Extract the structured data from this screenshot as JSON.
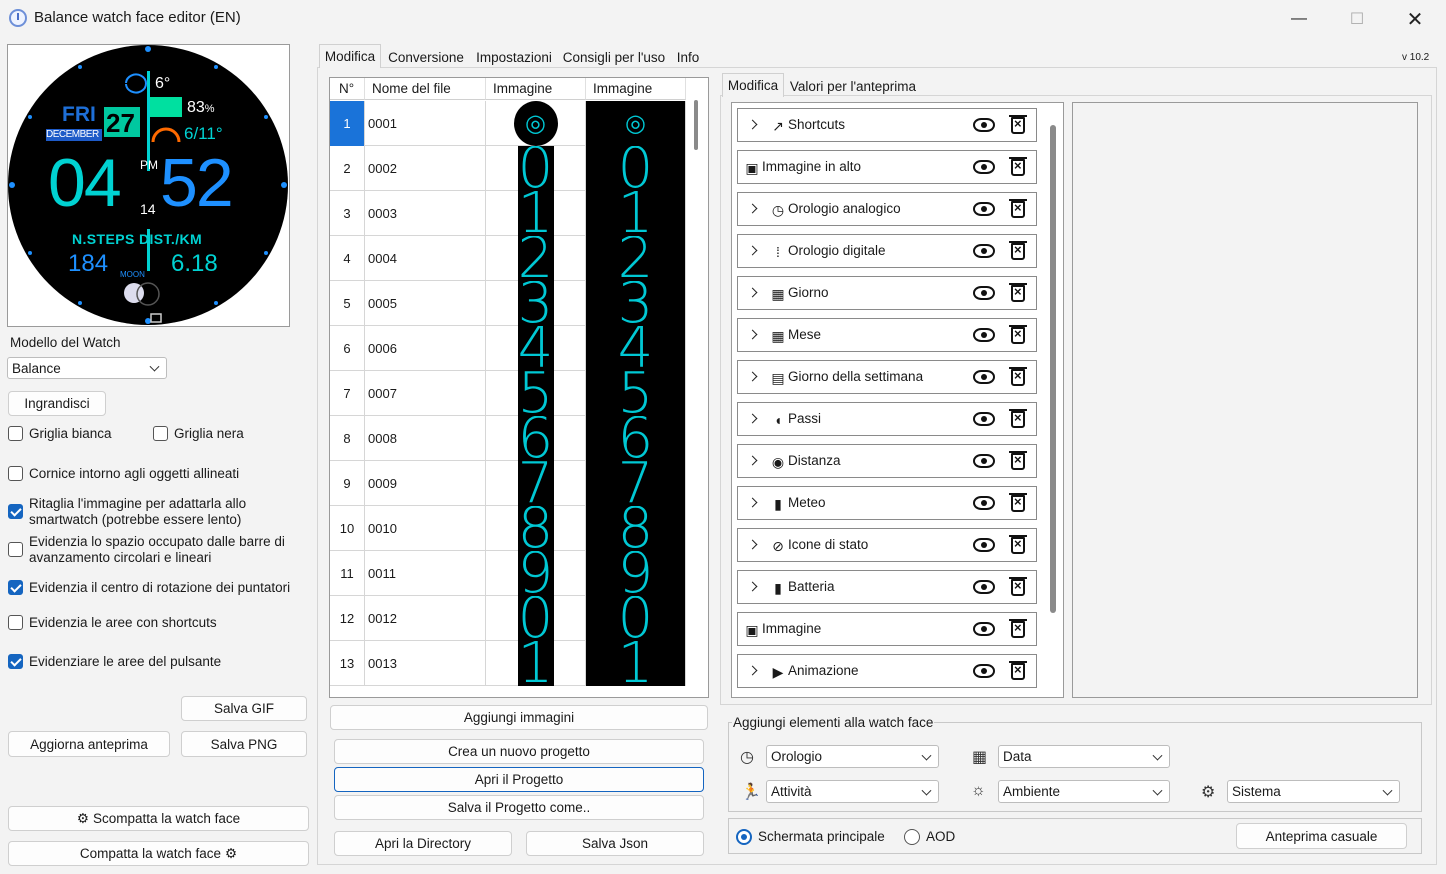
{
  "window": {
    "title": "Balance watch face editor (EN)",
    "version": "v 10.2",
    "min": "—",
    "max": "☐",
    "close": "✕"
  },
  "watch": {
    "weather_temp": "6°",
    "battery": "83",
    "battery_unit": "%",
    "day": "FRI",
    "date": "27",
    "month": "DECEMBER",
    "minmax": "6/11°",
    "ampm": "PM",
    "hour": "04",
    "minute": "52",
    "sun_val": "14",
    "labels": "N.STEPS DIST./KM",
    "steps": "184",
    "dist": "6.18",
    "moon": "MOON"
  },
  "left": {
    "model_label": "Modello del Watch",
    "model_value": "Balance",
    "zoom_button": "Ingrandisci",
    "checkboxes": [
      {
        "label": "Griglia bianca",
        "checked": false
      },
      {
        "label": "Griglia nera",
        "checked": false
      },
      {
        "label": "Cornice intorno agli oggetti allineati",
        "checked": false
      },
      {
        "label": "Ritaglia l'immagine per adattarla allo smartwatch (potrebbe essere lento)",
        "checked": true
      },
      {
        "label": "Evidenzia lo spazio occupato dalle barre di avanzamento circolari e lineari",
        "checked": false
      },
      {
        "label": "Evidenzia il centro di rotazione dei puntatori",
        "checked": true
      },
      {
        "label": "Evidenzia le aree con shortcuts",
        "checked": false
      },
      {
        "label": "Evidenziare le aree del pulsante",
        "checked": true
      }
    ],
    "save_gif": "Salva GIF",
    "update_preview": "Aggiorna anteprima",
    "save_png": "Salva PNG",
    "unpack": "Scompatta la watch face",
    "pack": "Compatta la watch face"
  },
  "tabs": [
    "Modifica",
    "Conversione",
    "Impostazioni",
    "Consigli per l'uso",
    "Info"
  ],
  "grid": {
    "headers": [
      "N°",
      "Nome del file",
      "Immagine",
      "Immagine"
    ],
    "rows": [
      {
        "n": "1",
        "name": "0001",
        "glyph": "◎"
      },
      {
        "n": "2",
        "name": "0002",
        "glyph": "0"
      },
      {
        "n": "3",
        "name": "0003",
        "glyph": "1"
      },
      {
        "n": "4",
        "name": "0004",
        "glyph": "2"
      },
      {
        "n": "5",
        "name": "0005",
        "glyph": "3"
      },
      {
        "n": "6",
        "name": "0006",
        "glyph": "4"
      },
      {
        "n": "7",
        "name": "0007",
        "glyph": "5"
      },
      {
        "n": "8",
        "name": "0008",
        "glyph": "6"
      },
      {
        "n": "9",
        "name": "0009",
        "glyph": "7"
      },
      {
        "n": "10",
        "name": "0010",
        "glyph": "8"
      },
      {
        "n": "11",
        "name": "0011",
        "glyph": "9"
      },
      {
        "n": "12",
        "name": "0012",
        "glyph": "0"
      },
      {
        "n": "13",
        "name": "0013",
        "glyph": "1"
      }
    ]
  },
  "mid_buttons": {
    "add_images": "Aggiungi immagini",
    "new_project": "Crea un nuovo progetto",
    "open_project": "Apri il Progetto",
    "save_project": "Salva il Progetto come..",
    "open_dir": "Apri la Directory",
    "save_json": "Salva Json"
  },
  "right_tabs": [
    "Modifica",
    "Valori per l'anteprima"
  ],
  "elements": [
    {
      "name": "Shortcuts",
      "icon": "↗",
      "expand": true
    },
    {
      "name": "Immagine in alto",
      "icon": "▣",
      "expand": false
    },
    {
      "name": "Orologio analogico",
      "icon": "◷",
      "expand": true
    },
    {
      "name": "Orologio digitale",
      "icon": "⁞",
      "expand": true
    },
    {
      "name": "Giorno",
      "icon": "▦",
      "expand": true
    },
    {
      "name": "Mese",
      "icon": "▦",
      "expand": true
    },
    {
      "name": "Giorno della settimana",
      "icon": "▤",
      "expand": true
    },
    {
      "name": "Passi",
      "icon": "◖",
      "expand": true
    },
    {
      "name": "Distanza",
      "icon": "◉",
      "expand": true
    },
    {
      "name": "Meteo",
      "icon": "▮",
      "expand": true
    },
    {
      "name": "Icone di stato",
      "icon": "⊘",
      "expand": true
    },
    {
      "name": "Batteria",
      "icon": "▮",
      "expand": true
    },
    {
      "name": "Immagine",
      "icon": "▣",
      "expand": false
    },
    {
      "name": "Animazione",
      "icon": "▶",
      "expand": true
    }
  ],
  "add_section": {
    "title": "Aggiungi elementi alla watch face",
    "clock": "Orologio",
    "date": "Data",
    "activity": "Attività",
    "environment": "Ambiente",
    "system": "Sistema"
  },
  "bottom": {
    "main_screen": "Schermata principale",
    "aod": "AOD",
    "random_preview": "Anteprima casuale"
  }
}
